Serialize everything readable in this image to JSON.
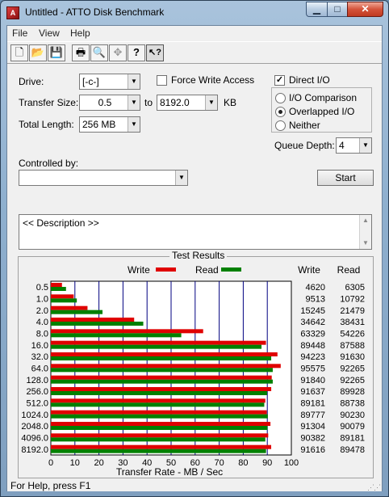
{
  "window": {
    "icon_text": "A",
    "title": "Untitled - ATTO Disk Benchmark",
    "min_glyph": "▁",
    "max_glyph": "□",
    "close_glyph": "✕"
  },
  "menu": [
    "File",
    "View",
    "Help"
  ],
  "toolbar": {
    "new_glyph": "🗋",
    "open_glyph": "📂",
    "save_glyph": "💾",
    "print_glyph": "🖶",
    "preview_glyph": "🔍",
    "move_glyph": "✥",
    "help_glyph": "?",
    "context_help_glyph": "↖?"
  },
  "drive": {
    "label": "Drive:",
    "value": "[-c-]"
  },
  "transfer_size": {
    "label": "Transfer Size:",
    "from": "0.5",
    "to_label": "to",
    "to": "8192.0",
    "unit": "KB"
  },
  "total_length": {
    "label": "Total Length:",
    "value": "256 MB"
  },
  "force_write_access": {
    "label": "Force Write Access",
    "checked": false
  },
  "direct_io": {
    "label": "Direct I/O",
    "checked": true,
    "mark": "✓"
  },
  "io_mode": {
    "options": [
      "I/O Comparison",
      "Overlapped I/O",
      "Neither"
    ],
    "selected": "Overlapped I/O"
  },
  "queue_depth": {
    "label": "Queue Depth:",
    "value": "4"
  },
  "controlled_by": {
    "label": "Controlled by:",
    "value": ""
  },
  "start_button": "Start",
  "description": "<< Description >>",
  "results": {
    "title": "Test Results",
    "legend_write": "Write",
    "legend_read": "Read",
    "col_write": "Write",
    "col_read": "Read"
  },
  "chart_data": {
    "type": "bar",
    "orientation": "horizontal",
    "categories": [
      "0.5",
      "1.0",
      "2.0",
      "4.0",
      "8.0",
      "16.0",
      "32.0",
      "64.0",
      "128.0",
      "256.0",
      "512.0",
      "1024.0",
      "2048.0",
      "4096.0",
      "8192.0"
    ],
    "series": [
      {
        "name": "Write",
        "color": "#e00000",
        "values": [
          4620,
          9513,
          15245,
          34642,
          63329,
          89448,
          94223,
          95575,
          91840,
          91637,
          89181,
          89777,
          91304,
          90382,
          91616
        ]
      },
      {
        "name": "Read",
        "color": "#008000",
        "values": [
          6305,
          10792,
          21479,
          38431,
          54226,
          87588,
          91630,
          92265,
          92265,
          89928,
          88738,
          90230,
          90079,
          89181,
          89478
        ]
      }
    ],
    "xlabel": "Transfer Rate - MB / Sec",
    "xticks": [
      0,
      10,
      20,
      30,
      40,
      50,
      60,
      70,
      80,
      90,
      100
    ],
    "xlim": [
      0,
      100
    ],
    "value_scale_note": "bars plot KB/s / 1000",
    "legend_position": "top"
  },
  "status": "For Help, press F1"
}
